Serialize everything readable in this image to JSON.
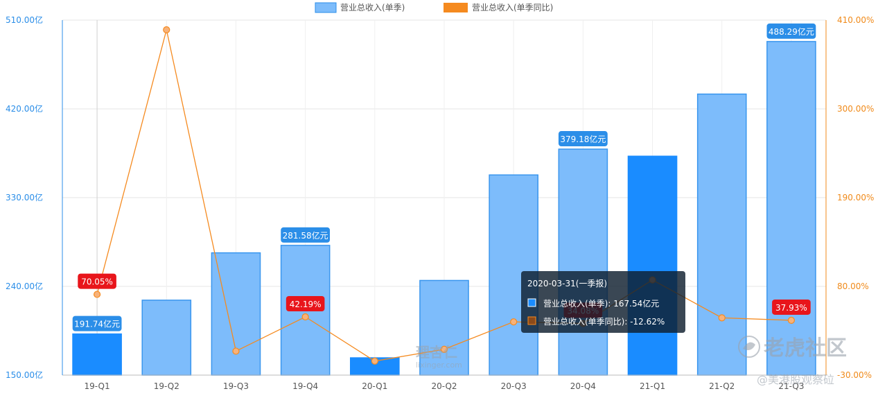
{
  "chart_data": {
    "type": "bar",
    "categories": [
      "19-Q1",
      "19-Q2",
      "19-Q3",
      "19-Q4",
      "20-Q1",
      "20-Q2",
      "20-Q3",
      "20-Q4",
      "21-Q1",
      "21-Q2",
      "21-Q3"
    ],
    "series": [
      {
        "name": "营业总收入(单季)",
        "type": "bar",
        "axis": "left",
        "unit": "亿元",
        "values": [
          191.74,
          226.0,
          274.0,
          281.58,
          167.54,
          246.0,
          353.0,
          379.18,
          372.0,
          435.0,
          488.29
        ],
        "color": "#7dbcfb",
        "highlight_color": "#1a8cff",
        "highlighted": [
          0,
          4,
          8
        ]
      },
      {
        "name": "营业总收入(单季同比)",
        "type": "line",
        "axis": "right",
        "unit": "%",
        "values": [
          70.05,
          398.0,
          -0.3,
          42.19,
          -12.62,
          2.0,
          36.0,
          34.08,
          88.0,
          41.0,
          37.93
        ],
        "color": "#f58a1f"
      }
    ],
    "left_axis": {
      "ticks": [
        "150.00亿",
        "240.00亿",
        "330.00亿",
        "420.00亿",
        "510.00亿"
      ],
      "range": [
        150,
        510
      ]
    },
    "right_axis": {
      "ticks": [
        "-30.00%",
        "80.00%",
        "190.00%",
        "300.00%",
        "410.00%"
      ],
      "range": [
        -30,
        410
      ]
    },
    "bar_labels": [
      {
        "index": 0,
        "text": "191.74亿元"
      },
      {
        "index": 3,
        "text": "281.58亿元"
      },
      {
        "index": 7,
        "text": "379.18亿元"
      },
      {
        "index": 10,
        "text": "488.29亿元"
      }
    ],
    "line_labels": [
      {
        "index": 0,
        "text": "70.05%"
      },
      {
        "index": 3,
        "text": "42.19%"
      },
      {
        "index": 7,
        "text": "34.08%"
      },
      {
        "index": 10,
        "text": "37.93%"
      }
    ],
    "tooltip": {
      "title": "2020-03-31(一季报)",
      "rows": [
        "营业总收入(单季): 167.54亿元",
        "营业总收入(单季同比): -12.62%"
      ]
    },
    "grid": true,
    "legend_position": "top-center"
  },
  "watermarks": {
    "center_logo": "理杏仁",
    "center_url": "lixinger.com",
    "brand": "老虎社区",
    "handle": "@美港股观察砬"
  }
}
